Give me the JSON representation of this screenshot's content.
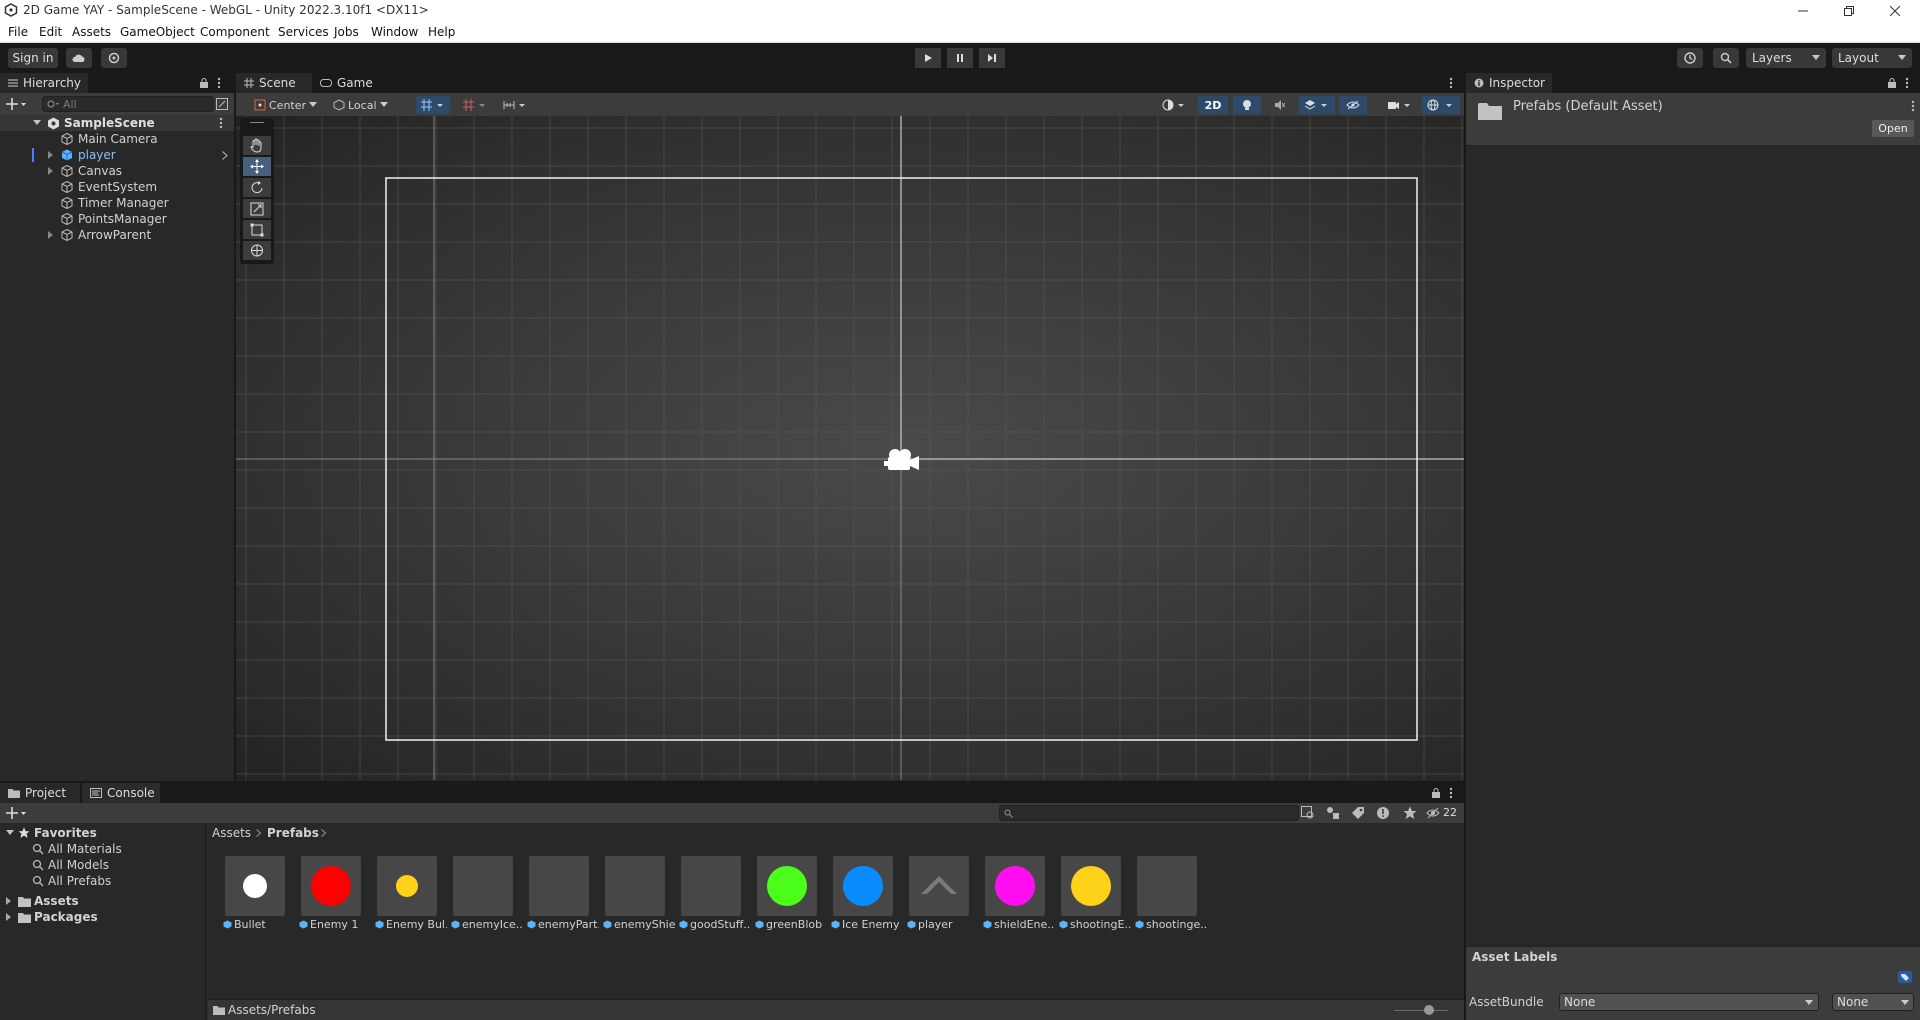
{
  "window": {
    "title": "2D Game YAY - SampleScene - WebGL - Unity 2022.3.10f1 <DX11>"
  },
  "menu": [
    "File",
    "Edit",
    "Assets",
    "GameObject",
    "Component",
    "Services",
    "Jobs",
    "Window",
    "Help"
  ],
  "toolbar": {
    "signin": "Sign in",
    "layers": "Layers",
    "layout": "Layout"
  },
  "hierarchy": {
    "tab": "Hierarchy",
    "search_placeholder": "All",
    "scene": "SampleScene",
    "items": [
      "Main Camera",
      "player",
      "Canvas",
      "EventSystem",
      "Timer Manager",
      "PointsManager",
      "ArrowParent"
    ]
  },
  "scene": {
    "tabs": [
      "Scene",
      "Game"
    ],
    "pivot": "Center",
    "space": "Local",
    "mode_2d": "2D"
  },
  "inspector": {
    "tab": "Inspector",
    "asset_title": "Prefabs (Default Asset)",
    "open_label": "Open",
    "asset_labels": "Asset Labels",
    "assetbundle_label": "AssetBundle",
    "bundle_value": "None",
    "variant_value": "None"
  },
  "project": {
    "tabs": [
      "Project",
      "Console"
    ],
    "hidden_count": "22",
    "favorites": "Favorites",
    "fav_items": [
      "All Materials",
      "All Models",
      "All Prefabs"
    ],
    "roots": [
      "Assets",
      "Packages"
    ],
    "breadcrumb": [
      "Assets",
      "Prefabs"
    ],
    "footer_path": "Assets/Prefabs",
    "assets": [
      {
        "name": "Bullet",
        "color": "#ffffff",
        "shape": "circle-sm"
      },
      {
        "name": "Enemy 1",
        "color": "#ff0000",
        "shape": "circle"
      },
      {
        "name": "Enemy Bul...",
        "color": "#ffd21a",
        "shape": "circle-xs"
      },
      {
        "name": "enemyIce...",
        "color": "",
        "shape": "empty"
      },
      {
        "name": "enemyPart...",
        "color": "",
        "shape": "empty"
      },
      {
        "name": "enemyShie...",
        "color": "",
        "shape": "empty"
      },
      {
        "name": "goodStuff...",
        "color": "",
        "shape": "empty"
      },
      {
        "name": "greenBlob",
        "color": "#4cff1a",
        "shape": "circle"
      },
      {
        "name": "Ice Enemy",
        "color": "#0a8cff",
        "shape": "circle"
      },
      {
        "name": "player",
        "color": "#7a7a7a",
        "shape": "chevron"
      },
      {
        "name": "shieldEne...",
        "color": "#ff0ff0",
        "shape": "circle"
      },
      {
        "name": "shootingE...",
        "color": "#ffd21a",
        "shape": "circle"
      },
      {
        "name": "shootinge...",
        "color": "",
        "shape": "empty"
      }
    ]
  }
}
